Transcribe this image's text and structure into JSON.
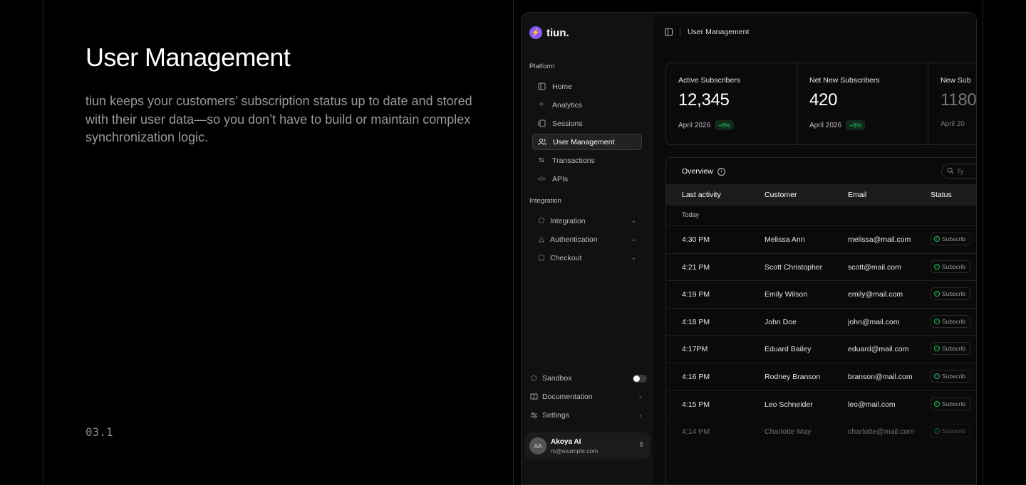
{
  "left": {
    "title": "User Management",
    "description": "tiun keeps your customers’ subscription status up to date and stored with their user data—so you don’t have to build or maintain complex synchronization logic.",
    "section_number": "03.1"
  },
  "app": {
    "brand": "tiun.",
    "sidebar": {
      "platform_label": "Platform",
      "platform_items": [
        {
          "label": "Home",
          "icon": "home-icon"
        },
        {
          "label": "Analytics",
          "icon": "sparkle-icon"
        },
        {
          "label": "Sessions",
          "icon": "sessions-icon"
        },
        {
          "label": "User Management",
          "icon": "users-icon",
          "active": true
        },
        {
          "label": "Transactions",
          "icon": "transfer-icon"
        },
        {
          "label": "APIs",
          "icon": "code-icon"
        }
      ],
      "integration_label": "Integration",
      "integration_items": [
        {
          "label": "Integration",
          "icon": "pentagon-icon"
        },
        {
          "label": "Authentication",
          "icon": "triangle-icon"
        },
        {
          "label": "Checkout",
          "icon": "square-icon"
        }
      ],
      "bottom": {
        "sandbox": "Sandbox",
        "documentation": "Documentation",
        "settings": "Settings"
      },
      "user": {
        "initials": "AA",
        "name": "Akoya AI",
        "email": "m@example.com"
      }
    },
    "topbar": {
      "title": "User Management"
    },
    "stats": [
      {
        "label": "Active Subscribers",
        "value": "12,345",
        "period": "April 2026",
        "delta": "+8%"
      },
      {
        "label": "Net New Subscribers",
        "value": "420",
        "period": "April 2026",
        "delta": "+8%"
      },
      {
        "label": "New Sub",
        "value": "1180",
        "period": "April 20",
        "delta": ""
      }
    ],
    "table": {
      "title": "Overview",
      "search_placeholder": "Ty",
      "columns": [
        "Last activity",
        "Customer",
        "Email",
        "Status"
      ],
      "group": "Today",
      "status_label": "Subscrib",
      "rows": [
        {
          "time": "4:30 PM",
          "customer": "Melissa Ann",
          "email": "melissa@mail.com"
        },
        {
          "time": "4:21 PM",
          "customer": "Scott Christopher",
          "email": "scott@mail.com"
        },
        {
          "time": "4:19 PM",
          "customer": "Emily Wilson",
          "email": "emily@mail.com"
        },
        {
          "time": "4:18 PM",
          "customer": "John Doe",
          "email": "john@mail.com"
        },
        {
          "time": "4:17PM",
          "customer": "Eduard Bailey",
          "email": "eduard@mail.com"
        },
        {
          "time": "4:16 PM",
          "customer": "Rodney Branson",
          "email": "branson@mail.com"
        },
        {
          "time": "4:15 PM",
          "customer": "Leo Schneider",
          "email": "leo@mail.com"
        },
        {
          "time": "4:14 PM",
          "customer": "Charlotte May",
          "email": "charlotte@mail.com"
        }
      ]
    }
  }
}
